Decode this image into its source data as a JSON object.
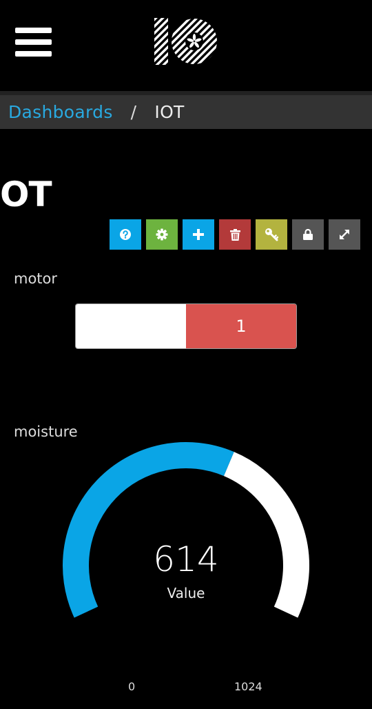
{
  "header": {
    "menu_icon": "hamburger-menu-icon",
    "logo_icon": "adafruit-io-logo"
  },
  "breadcrumb": {
    "root": "Dashboards",
    "separator": "/",
    "current": "IOT"
  },
  "page": {
    "title": "OT"
  },
  "toolbar": {
    "buttons": [
      {
        "icon": "question-icon",
        "color": "#0aa5e6"
      },
      {
        "icon": "gear-icon",
        "color": "#6db33f"
      },
      {
        "icon": "plus-icon",
        "color": "#0aa5e6"
      },
      {
        "icon": "trash-icon",
        "color": "#b33a3a"
      },
      {
        "icon": "key-icon",
        "color": "#b3b33f"
      },
      {
        "icon": "lock-icon",
        "color": "#555555"
      },
      {
        "icon": "expand-icon",
        "color": "#555555"
      }
    ]
  },
  "motor": {
    "label": "motor",
    "value": "1",
    "on_color": "#d9534f",
    "off_color": "#ffffff"
  },
  "moisture": {
    "label": "moisture",
    "value": 614,
    "value_text": "614",
    "sub_label": "Value",
    "min": 0,
    "max": 1024,
    "min_text": "0",
    "max_text": "1024",
    "fill_color": "#0aa5e6",
    "track_color": "#ffffff"
  }
}
